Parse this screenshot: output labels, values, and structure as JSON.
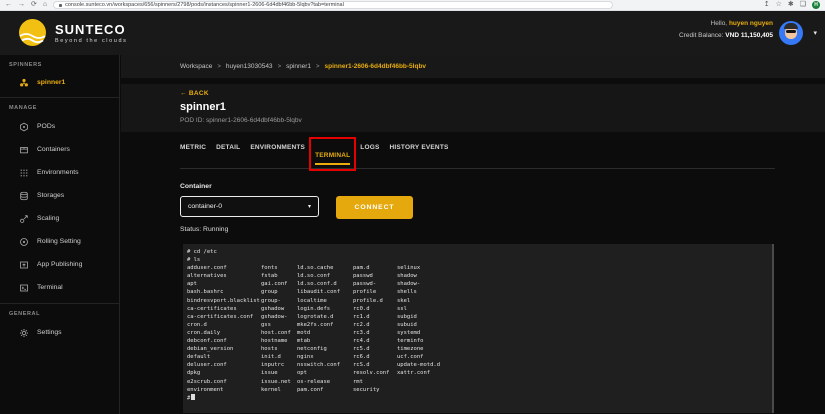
{
  "browser": {
    "url": "console.sunteco.vn/workspaces/656/spinners/2798/pods/instances/spinner1-2606-6d4dbf46bb-5lqbv?tab=terminal",
    "profile_initial": "H"
  },
  "icons": {
    "back": "←",
    "forward": "→",
    "reload": "⟳",
    "home": "⌂",
    "share": "↥",
    "bookmark": "☆",
    "extensions": "✱",
    "window": "❏",
    "caret_down": "▾",
    "breadcrumb_sep": ">",
    "back_arrow": "←"
  },
  "header": {
    "brand": "SUNTECO",
    "tagline": "Beyond the clouds",
    "greeting_prefix": "Hello,",
    "username": "huyen nguyen",
    "credit_label": "Credit Balance:",
    "credit_value": "VND 11,150,405"
  },
  "sidebar": {
    "section_spinners": "SPINNERS",
    "spinner_name": "spinner1",
    "section_manage": "MANAGE",
    "manage_items": [
      "PODs",
      "Containers",
      "Environments",
      "Storages",
      "Scaling",
      "Rolling Setting",
      "App Publishing",
      "Terminal"
    ],
    "section_general": "GENERAL",
    "settings_label": "Settings"
  },
  "breadcrumb": {
    "items": [
      "Workspace",
      "huyen13030543",
      "spinner1"
    ],
    "current": "spinner1-2606-6d4dbf46bb-5lqbv"
  },
  "pod_header": {
    "back": "BACK",
    "title": "spinner1",
    "pod_id": "POD ID: spinner1-2606-6d4dbf46bb-5lqbv"
  },
  "tabs": [
    "METRIC",
    "DETAIL",
    "ENVIRONMENTS",
    "TERMINAL",
    "LOGS",
    "HISTORY EVENTS"
  ],
  "active_tab": "TERMINAL",
  "controls": {
    "container_label": "Container",
    "container_value": "container-0",
    "connect_label": "CONNECT",
    "status": "Status: Running"
  },
  "terminal": {
    "commands": [
      "# cd /etc",
      "# ls"
    ],
    "listing": [
      [
        "adduser.conf",
        "fonts",
        "ld.so.cache",
        "pam.d",
        "selinux"
      ],
      [
        "alternatives",
        "fstab",
        "ld.so.conf",
        "passwd",
        "shadow"
      ],
      [
        "apt",
        "gai.conf",
        "ld.so.conf.d",
        "passwd-",
        "shadow-"
      ],
      [
        "bash.bashrc",
        "group",
        "libaudit.conf",
        "profile",
        "shells"
      ],
      [
        "bindresvport.blacklist",
        "group-",
        "localtime",
        "profile.d",
        "skel"
      ],
      [
        "ca-certificates",
        "gshadow",
        "login.defs",
        "rc0.d",
        "ssl"
      ],
      [
        "ca-certificates.conf",
        "gshadow-",
        "logrotate.d",
        "rc1.d",
        "subgid"
      ],
      [
        "cron.d",
        "gss",
        "mke2fs.conf",
        "rc2.d",
        "subuid"
      ],
      [
        "cron.daily",
        "host.conf",
        "motd",
        "rc3.d",
        "systemd"
      ],
      [
        "debconf.conf",
        "hostname",
        "mtab",
        "rc4.d",
        "terminfo"
      ],
      [
        "debian_version",
        "hosts",
        "netconfig",
        "rc5.d",
        "timezone"
      ],
      [
        "default",
        "init.d",
        "nginx",
        "rc6.d",
        "ucf.conf"
      ],
      [
        "deluser.conf",
        "inputrc",
        "nsswitch.conf",
        "rcS.d",
        "update-motd.d"
      ],
      [
        "dpkg",
        "issue",
        "opt",
        "resolv.conf",
        "xattr.conf"
      ],
      [
        "e2scrub.conf",
        "issue.net",
        "os-release",
        "rmt",
        ""
      ],
      [
        "environment",
        "kernel",
        "pam.conf",
        "security",
        ""
      ]
    ],
    "prompt": "#"
  },
  "colors": {
    "accent_yellow": "#e9ad0e",
    "annotation_red": "#e60000",
    "terminal_bg": "#1f1f1f"
  }
}
